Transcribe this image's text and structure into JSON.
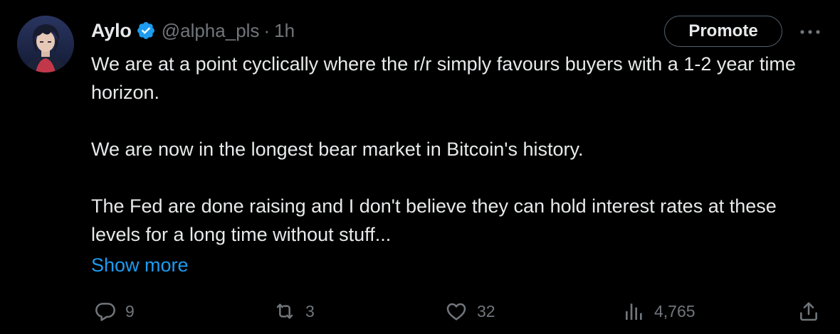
{
  "tweet": {
    "author": {
      "display_name": "Aylo",
      "handle": "@alpha_pls",
      "separator": "·",
      "time": "1h",
      "verified_icon": "verified-badge-icon"
    },
    "promote_label": "Promote",
    "more_icon": "more-options-icon",
    "text": {
      "paragraph_1": "We are at a point cyclically where the r/r simply favours buyers with a 1-2 year time horizon.",
      "paragraph_2": "We are now in the longest bear market in Bitcoin's history.",
      "paragraph_3": "The Fed are done raising and I don't believe they can hold interest rates at these levels for a long time without stuff..."
    },
    "show_more_label": "Show more",
    "actions": {
      "replies": "9",
      "retweets": "3",
      "likes": "32",
      "views": "4,765"
    }
  },
  "colors": {
    "background": "#000000",
    "primary_text": "#e7e9ea",
    "secondary_text": "#71767b",
    "link": "#1d9bf0",
    "verified": "#1d9bf0"
  }
}
